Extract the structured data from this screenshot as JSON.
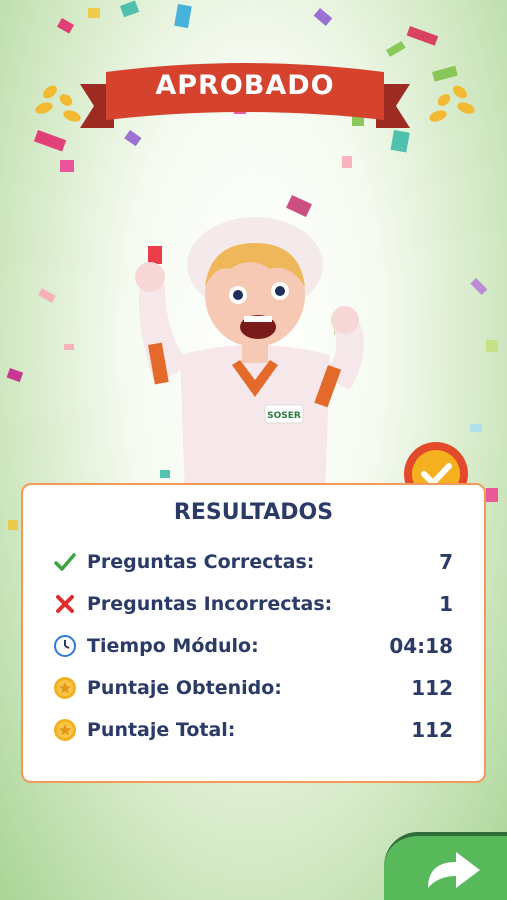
{
  "banner": {
    "title": "APROBADO"
  },
  "results": {
    "title": "RESULTADOS",
    "rows": [
      {
        "icon": "check-icon",
        "label": "Preguntas Correctas:",
        "value": "7"
      },
      {
        "icon": "cross-icon",
        "label": "Preguntas Incorrectas:",
        "value": "1"
      },
      {
        "icon": "clock-icon",
        "label": "Tiempo Módulo:",
        "value": "04:18"
      },
      {
        "icon": "star-coin-icon",
        "label": "Puntaje Obtenido:",
        "value": "112"
      },
      {
        "icon": "star-coin-icon",
        "label": "Puntaje Total:",
        "value": "112"
      }
    ]
  },
  "character": {
    "badge_text": "SOSER"
  },
  "colors": {
    "banner": "#d5432f",
    "card_border": "#f29a5a",
    "text": "#2b3a66",
    "next_button": "#57b95a"
  },
  "navigation": {
    "next_icon": "arrow-right-icon"
  }
}
